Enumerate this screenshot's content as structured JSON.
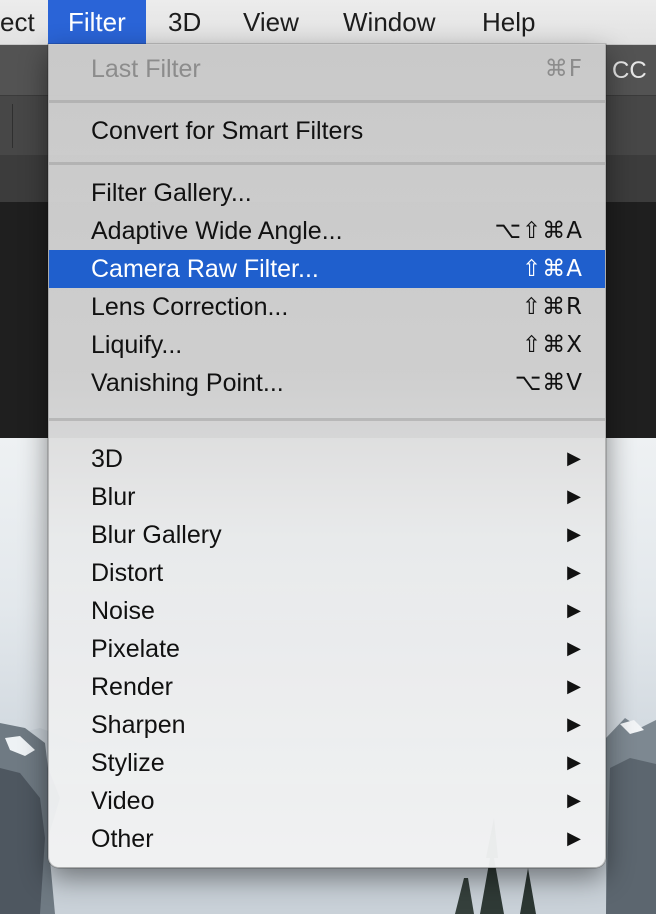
{
  "menubar": {
    "items": [
      "ect",
      "Filter",
      "3D",
      "View",
      "Window",
      "Help"
    ],
    "active_index": 1
  },
  "app": {
    "cc_label": "CC"
  },
  "filter_menu": {
    "last_filter": {
      "label": "Last Filter",
      "shortcut": "⌘F",
      "enabled": false
    },
    "convert": {
      "label": "Convert for Smart Filters"
    },
    "items": [
      {
        "label": "Filter Gallery...",
        "shortcut": ""
      },
      {
        "label": "Adaptive Wide Angle...",
        "shortcut": "⌥⇧⌘A"
      },
      {
        "label": "Camera Raw Filter...",
        "shortcut": "⇧⌘A",
        "highlighted": true
      },
      {
        "label": "Lens Correction...",
        "shortcut": "⇧⌘R"
      },
      {
        "label": "Liquify...",
        "shortcut": "⇧⌘X"
      },
      {
        "label": "Vanishing Point...",
        "shortcut": "⌥⌘V"
      }
    ],
    "submenus": [
      "3D",
      "Blur",
      "Blur Gallery",
      "Distort",
      "Noise",
      "Pixelate",
      "Render",
      "Sharpen",
      "Stylize",
      "Video",
      "Other"
    ],
    "submenu_arrow_icon": "triangle-right-icon"
  },
  "colors": {
    "highlight": "#1f5fcd",
    "menubar_active": "#2a64d7",
    "disabled_text": "#8c8c8c"
  }
}
